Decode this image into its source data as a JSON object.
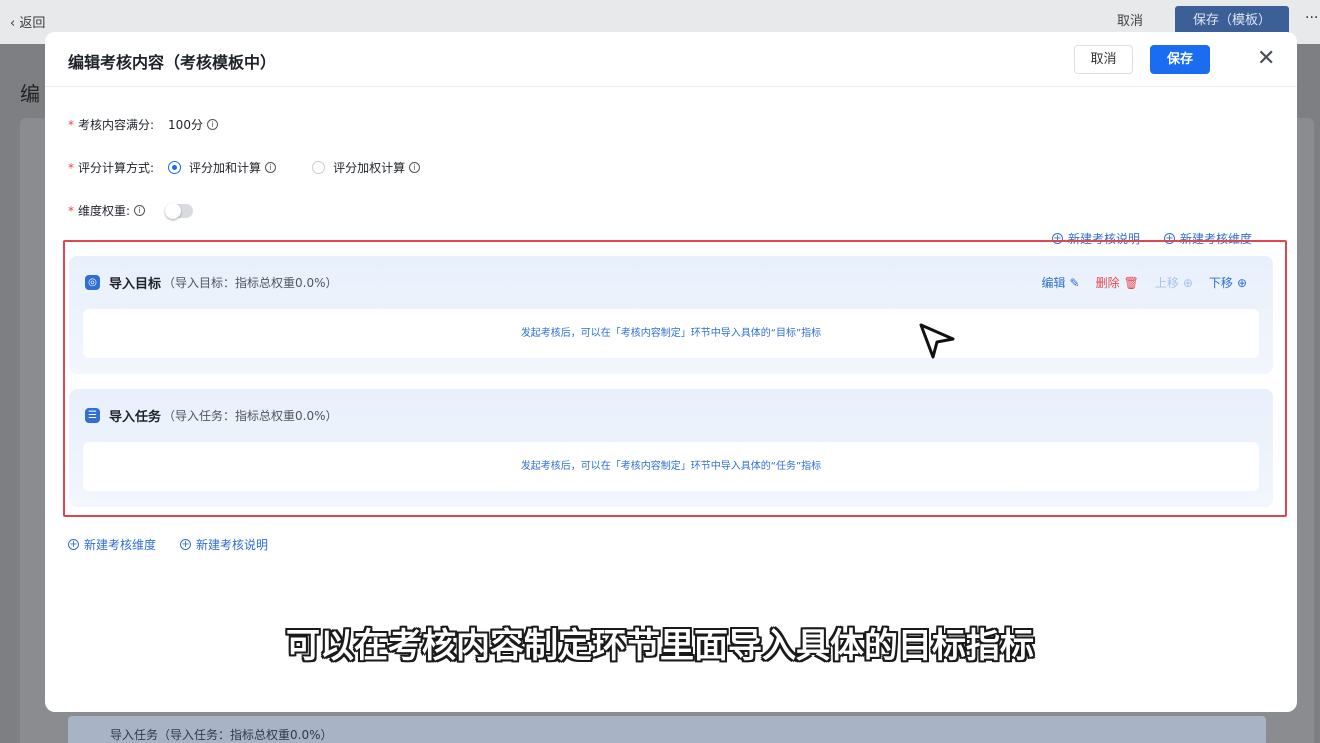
{
  "background": {
    "back_label": "返回",
    "cancel_label": "取消",
    "save_label": "保存（模板）",
    "more_label": "···",
    "page_title_fragment": "编",
    "bottom_row_text": "导入任务（导入任务：指标总权重0.0%）"
  },
  "modal": {
    "title": "编辑考核内容（考核模板中）",
    "cancel_label": "取消",
    "save_label": "保存",
    "close_symbol": "✕"
  },
  "form": {
    "full_score": {
      "label": "考核内容满分:",
      "value": "100分"
    },
    "calc_method": {
      "label": "评分计算方式:",
      "options": [
        "评分加和计算",
        "评分加权计算"
      ],
      "selected": "评分加和计算"
    },
    "dimension_weight": {
      "label": "维度权重:",
      "enabled": false
    }
  },
  "links": {
    "new_note": "新建考核说明",
    "new_dimension": "新建考核维度"
  },
  "dimensions": [
    {
      "name": "导入目标",
      "sub": "（导入目标：指标总权重0.0%）",
      "icon": "target-icon",
      "hint": "发起考核后，可以在「考核内容制定」环节中导入具体的“目标”指标"
    },
    {
      "name": "导入任务",
      "sub": "（导入任务：指标总权重0.0%）",
      "icon": "task-list-icon",
      "hint": "发起考核后，可以在「考核内容制定」环节中导入具体的“任务”指标"
    }
  ],
  "actions": {
    "edit": "编辑",
    "delete": "删除",
    "move_up": "上移",
    "move_down": "下移"
  },
  "subtitle": "可以在考核内容制定环节里面导入具体的目标指标",
  "colors": {
    "primary": "#1a6cf0",
    "link": "#2f6fd6",
    "danger": "#e5484d",
    "highlight_border": "#e0464f"
  }
}
